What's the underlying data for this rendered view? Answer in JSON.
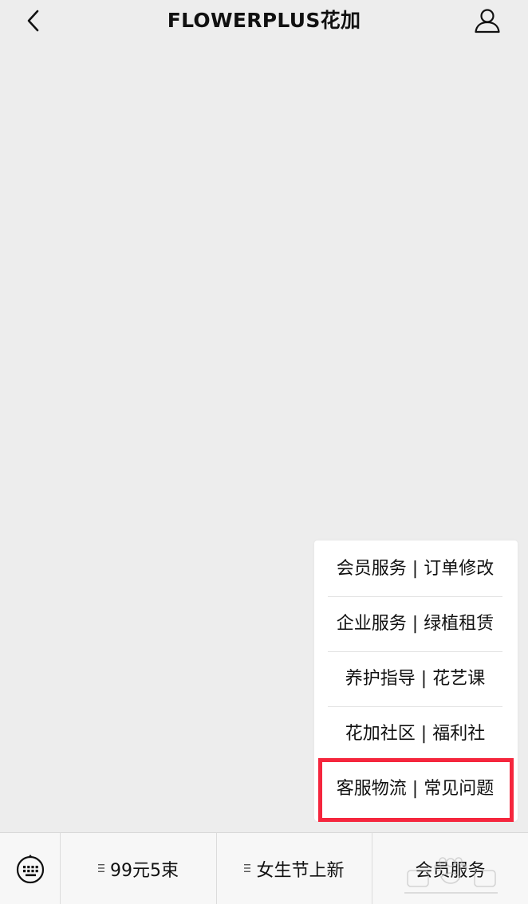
{
  "header": {
    "title": "FLOWERPLUS花加"
  },
  "submenu": {
    "items": [
      {
        "label": "会员服务 | 订单修改"
      },
      {
        "label": "企业服务 | 绿植租赁"
      },
      {
        "label": "养护指导 | 花艺课"
      },
      {
        "label": "花加社区 |  福利社"
      },
      {
        "label": "客服物流 | 常见问题"
      }
    ],
    "highlight_color": "#f5263d"
  },
  "bottom_menu": {
    "items": [
      {
        "label": "99元5束"
      },
      {
        "label": "女生节上新"
      },
      {
        "label": "会员服务"
      }
    ]
  },
  "icons": {
    "back": "chevron-left-icon",
    "profile": "user-icon",
    "keyboard": "keyboard-icon",
    "menu": "menu-lines-icon"
  }
}
